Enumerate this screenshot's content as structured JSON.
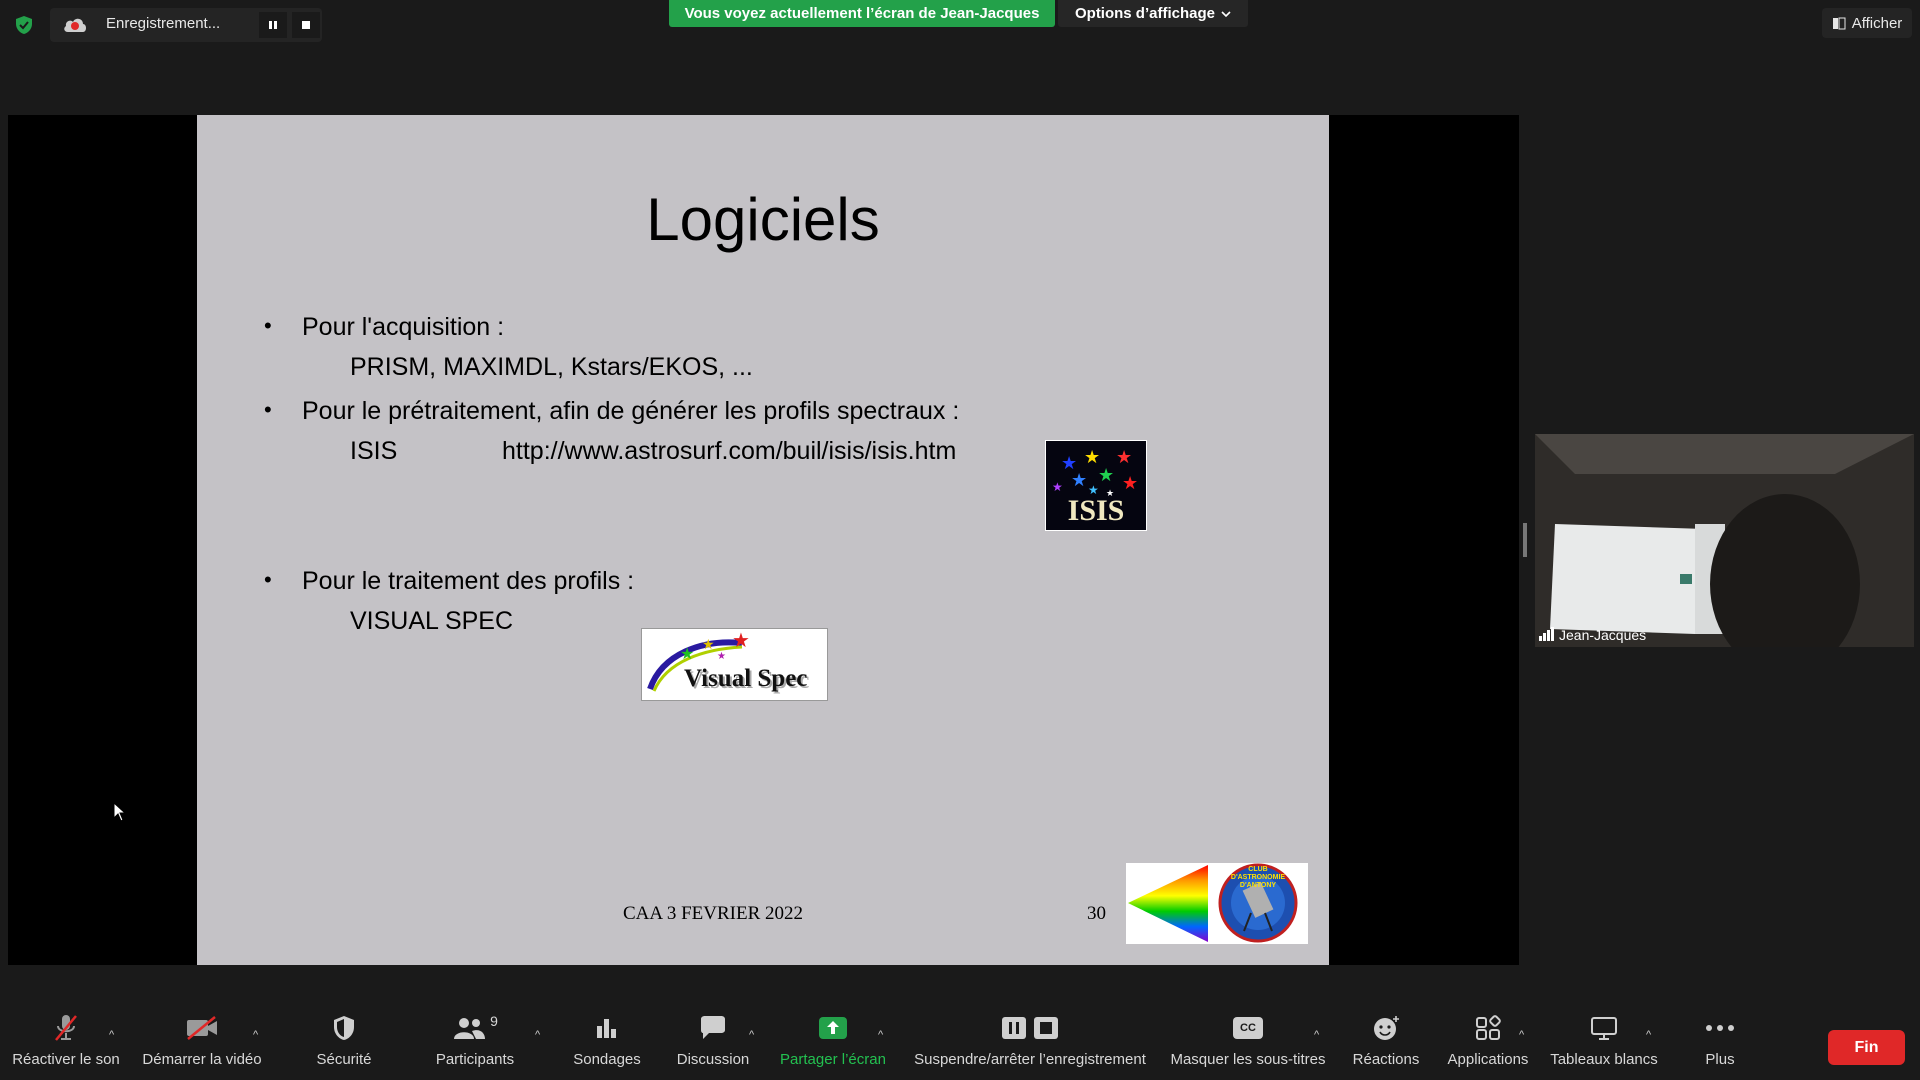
{
  "top_bar": {
    "recording_label": "Enregistrement...",
    "share_banner": "Vous voyez actuellement l’écran de Jean-Jacques",
    "view_options_label": "Options d’affichage",
    "afficher_label": "Afficher"
  },
  "slide": {
    "title": "Logiciels",
    "bullet1": "Pour l'acquisition :",
    "bullet1_sub": "PRISM, MAXIMDL, Kstars/EKOS, ...",
    "bullet2": "Pour le prétraitement, afin de générer les profils spectraux :",
    "bullet2_sub_name": "ISIS",
    "bullet2_sub_url": "http://www.astrosurf.com/buil/isis/isis.htm",
    "bullet3": "Pour le traitement des profils :",
    "bullet3_sub": "VISUAL SPEC",
    "footer_text": "CAA  3 FEVRIER 2022",
    "page_number": "30",
    "logo_isis_text": "ISIS",
    "logo_vs_text": "Visual Spec",
    "logo_caa_text": "CLUB D'ASTRONOMIE D'ANTONY"
  },
  "participant": {
    "name": "Jean-Jacques"
  },
  "toolbar": {
    "unmute": "Réactiver le son",
    "start_video": "Démarrer la vidéo",
    "security": "Sécurité",
    "participants": "Participants",
    "participants_count": "9",
    "polls": "Sondages",
    "chat": "Discussion",
    "share_screen": "Partager l’écran",
    "pause_record": "Suspendre/arrêter l’enregistrement",
    "captions": "Masquer les sous-titres",
    "captions_badge": "CC",
    "reactions": "Réactions",
    "apps": "Applications",
    "whiteboards": "Tableaux blancs",
    "more": "Plus",
    "end": "Fin"
  },
  "colors": {
    "share_green": "#23a14a",
    "end_red": "#e02828",
    "slide_bg": "#c4c2c6"
  }
}
